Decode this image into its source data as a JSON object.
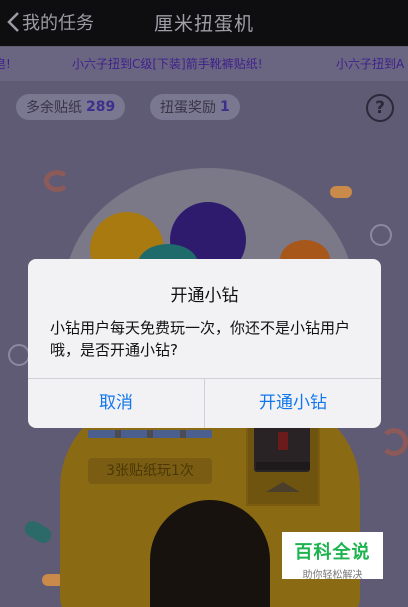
{
  "nav": {
    "back_label": "我的任务",
    "title": "厘米扭蛋机"
  },
  "ticker": [
    "皂!",
    "小六子扭到C级[下装]箭手靴裤贴纸!",
    "小六子扭到A"
  ],
  "stats": {
    "extra_stickers_label": "多余贴纸",
    "extra_stickers_value": "289",
    "gacha_reward_label": "扭蛋奖励",
    "gacha_reward_value": "1",
    "help_label": "?"
  },
  "machine": {
    "price_label": "3张贴纸玩1次"
  },
  "dialog": {
    "title": "开通小钻",
    "message": "小钻用户每天免费玩一次，你还不是小钻用户哦，是否开通小钻?",
    "cancel_label": "取消",
    "confirm_label": "开通小钻"
  },
  "watermark": {
    "title": "百科全说",
    "subtitle": "助你轻松解决"
  },
  "colors": {
    "accent": "#1277ee",
    "watermark_green": "#1db34f"
  }
}
